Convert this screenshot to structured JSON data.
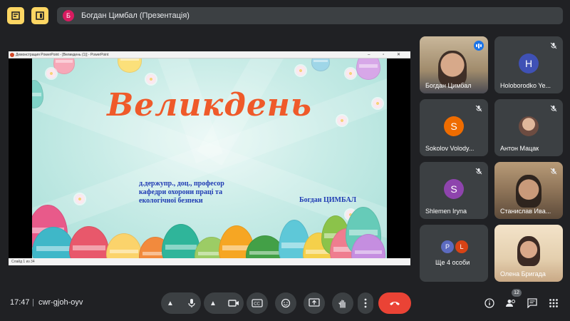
{
  "meeting": {
    "title": "Богдан Цимбал (Презентація)",
    "presenter_initial": "Б",
    "time": "17:47",
    "separator": "|",
    "code": "cwr-gjoh-oyv",
    "participants_count": "12"
  },
  "ppt_window": {
    "title": "Демонстрация PowerPoint - [Великдень (1)] - PowerPoint",
    "status": "Слайд 1 из 34"
  },
  "slide": {
    "heading": "Великдень",
    "subtitle": "д.держупр., доц., професор кафедри охорони праці та екологічної безпеки",
    "author": "Богдан ЦИМБАЛ"
  },
  "tiles": [
    {
      "name": "Богдан Цимбал"
    },
    {
      "name": "Holoborodko Ye...",
      "initial": "H"
    },
    {
      "name": "Sokolov Volody...",
      "initial": "S"
    },
    {
      "name": "Антон Мацак"
    },
    {
      "name": "Shlemen Iryna",
      "initial": "S"
    },
    {
      "name": "Станислав Ива..."
    },
    {
      "name": "Ще 4 особи",
      "initial_a": "P",
      "initial_b": "L"
    },
    {
      "name": "Олена Бригада"
    }
  ],
  "colors": {
    "background": "#202124",
    "tile": "#3c4043",
    "accent_yellow": "#fdd663",
    "end_call": "#ea4335",
    "slide_heading": "#ef5a2a",
    "slide_text": "#1f3bb3"
  },
  "icons": {
    "top_left_1": "hand-raise-list-icon",
    "top_left_2": "window-icon",
    "controls": [
      "chevron-up-icon",
      "mic-icon",
      "chevron-up-icon",
      "camera-icon",
      "captions-icon",
      "emoji-icon",
      "present-icon",
      "raise-hand-icon",
      "more-icon",
      "end-call-icon"
    ],
    "right": [
      "info-icon",
      "people-icon",
      "chat-icon",
      "activities-icon"
    ]
  }
}
